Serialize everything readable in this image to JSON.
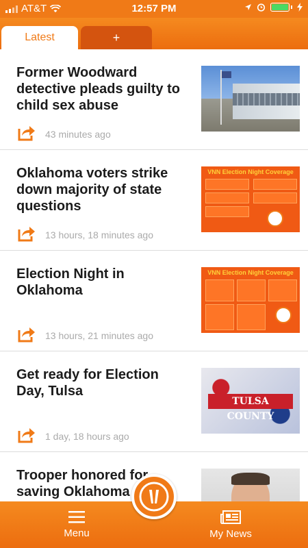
{
  "status": {
    "carrier": "AT&T",
    "time": "12:57 PM"
  },
  "tabs": [
    {
      "label": "Latest"
    },
    {
      "label": "+"
    }
  ],
  "articles": [
    {
      "headline": "Former Woodward detective pleads guilty to child sex abuse",
      "time": "43 minutes ago"
    },
    {
      "headline": "Oklahoma voters strike down majority of state questions",
      "time": "13 hours, 18 minutes ago"
    },
    {
      "headline": "Election Night in Oklahoma",
      "time": "13 hours, 21 minutes ago"
    },
    {
      "headline": "Get ready for Election Day, Tulsa",
      "time": "1 day, 18 hours ago"
    },
    {
      "headline": "Trooper honored for saving Oklahoma man's life",
      "time": ""
    }
  ],
  "thumb_text": {
    "vnn": "VNN Election Night Coverage",
    "tulsa": "TULSA COUNTY"
  },
  "nav": {
    "menu_label": "Menu",
    "news_label": "My News"
  },
  "icons": {
    "wifi": "wifi-icon",
    "location": "location-icon",
    "alarm": "alarm-icon",
    "battery": "battery-icon",
    "charging": "charging-icon",
    "share": "share-icon",
    "menu": "hamburger-icon",
    "news": "newspaper-icon",
    "logo": "logo-icon"
  },
  "colors": {
    "accent": "#f07a17",
    "accent_dark": "#d4540f",
    "battery": "#4cd964"
  }
}
